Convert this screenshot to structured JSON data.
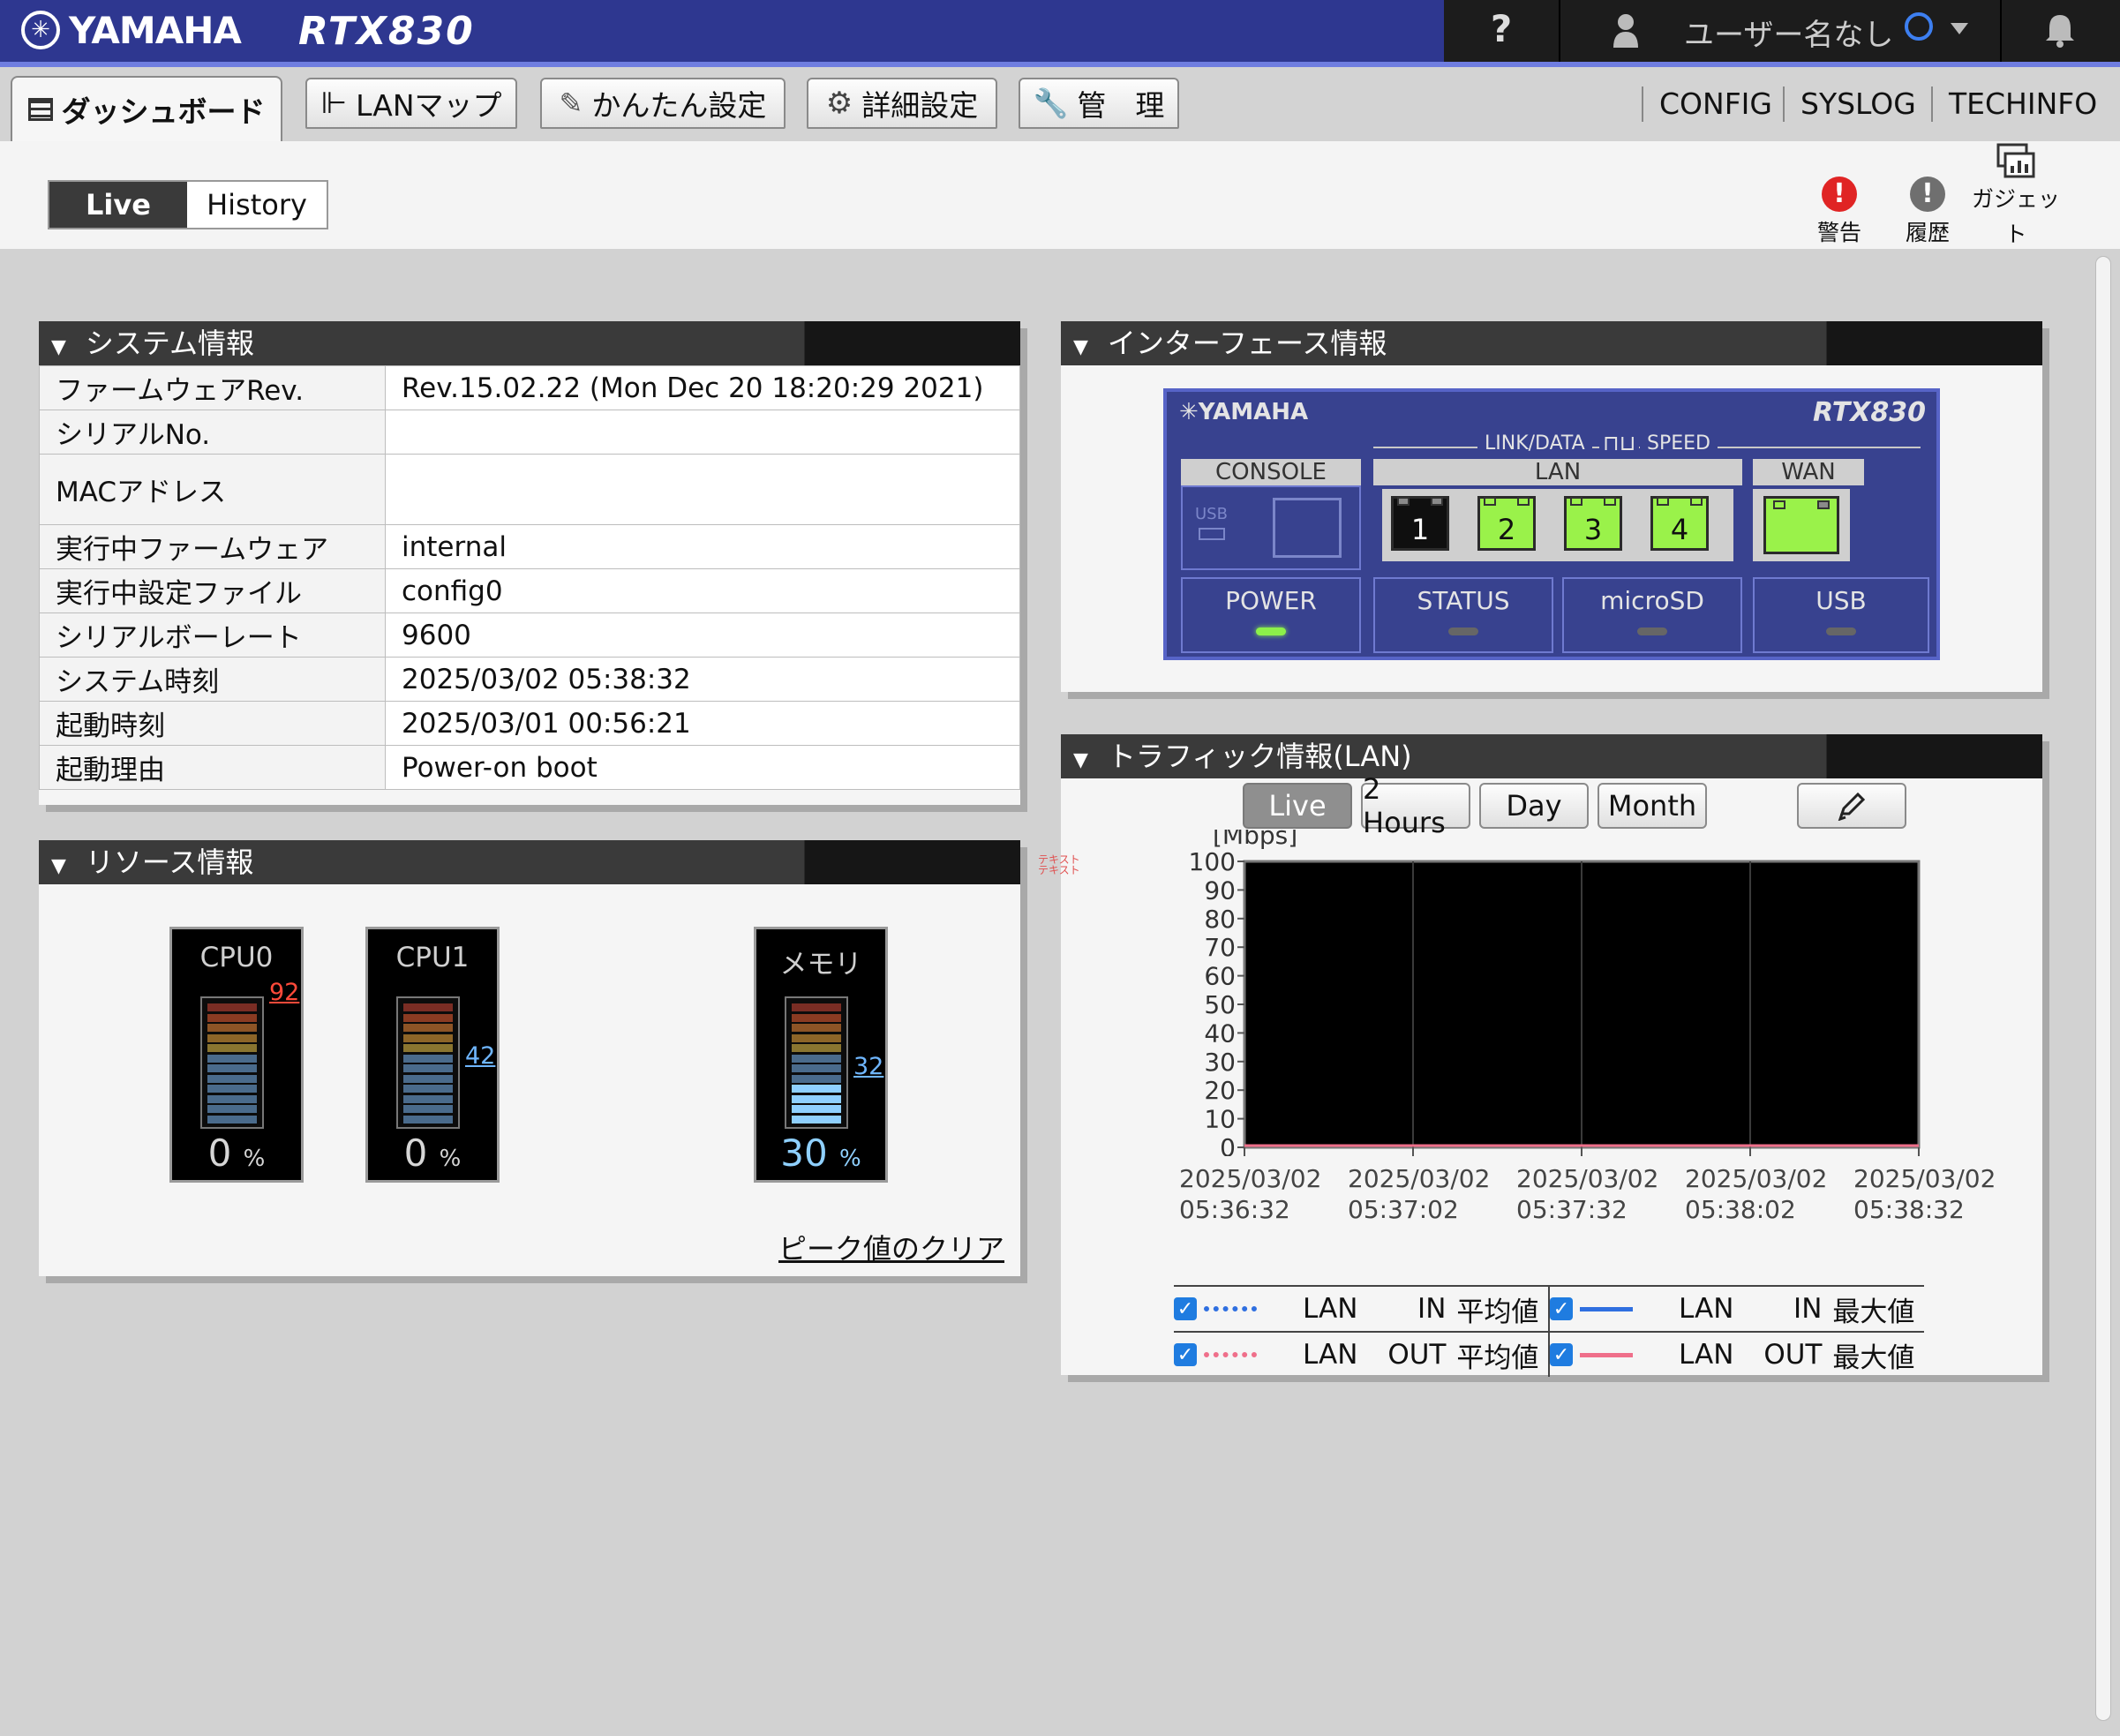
{
  "app": {
    "brand": "YAMAHA",
    "model": "RTX830"
  },
  "topbar": {
    "help": "?",
    "user_name": "ユーザー名なし"
  },
  "tabs": [
    {
      "label": "ダッシュボード",
      "icon": "dashboard-icon"
    },
    {
      "label": "LANマップ",
      "icon": "lan-map-icon"
    },
    {
      "label": "かんたん設定",
      "icon": "wand-icon"
    },
    {
      "label": "詳細設定",
      "icon": "gear-icon"
    },
    {
      "label": "管　理",
      "icon": "wrench-icon"
    }
  ],
  "top_links": [
    "CONFIG",
    "SYSLOG",
    "TECHINFO"
  ],
  "view_toggle": {
    "live": "Live",
    "history": "History"
  },
  "header_icons": {
    "warning": "警告",
    "history": "履歴",
    "gadget_line1": "ガジェッ",
    "gadget_line2": "ト"
  },
  "system": {
    "title": "システム情報",
    "rows": [
      {
        "key": "ファームウェアRev.",
        "value": "Rev.15.02.22 (Mon Dec 20 18:20:29 2021)"
      },
      {
        "key": "シリアルNo.",
        "value": ""
      },
      {
        "key": "MACアドレス",
        "value": ""
      },
      {
        "key": "実行中ファームウェア",
        "value": "internal"
      },
      {
        "key": "実行中設定ファイル",
        "value": "config0"
      },
      {
        "key": "シリアルボーレート",
        "value": "9600"
      },
      {
        "key": "システム時刻",
        "value": "2025/03/02 05:38:32"
      },
      {
        "key": "起動時刻",
        "value": "2025/03/01 00:56:21"
      },
      {
        "key": "起動理由",
        "value": "Power-on boot"
      }
    ]
  },
  "resource": {
    "title": "リソース情報",
    "gauges": [
      {
        "label": "CPU0",
        "value": "0",
        "unit": "%",
        "peak": "92",
        "peak_color": "#ff4a3a",
        "level": 0
      },
      {
        "label": "CPU1",
        "value": "0",
        "unit": "%",
        "peak": "42",
        "peak_color": "#6fb6ff",
        "level": 0
      },
      {
        "label": "メモリ",
        "value": "30",
        "unit": "%",
        "peak": "32",
        "peak_color": "#6fb6ff",
        "level": 30
      }
    ],
    "clear_peak": "ピーク値のクリア"
  },
  "interface": {
    "title": "インターフェース情報",
    "device": {
      "brand": "YAMAHA",
      "model": "RTX830",
      "link_data": "LINK/DATA",
      "speed": "SPEED",
      "console": "CONSOLE",
      "lan": "LAN",
      "wan": "WAN",
      "usb_small": "USB",
      "ports": [
        "1",
        "2",
        "3",
        "4"
      ],
      "port_states": [
        "down",
        "up",
        "up",
        "up"
      ],
      "leds": [
        {
          "label": "POWER",
          "on": true
        },
        {
          "label": "STATUS",
          "on": false
        },
        {
          "label": "microSD",
          "on": false
        },
        {
          "label": "USB",
          "on": false
        }
      ]
    }
  },
  "traffic": {
    "title": "トラフィック情報(LAN)",
    "buttons": [
      "Live",
      "2 Hours",
      "Day",
      "Month"
    ],
    "edit_icon": "pencil-icon",
    "note": "テキスト テキスト",
    "legend": [
      {
        "iface": "LAN",
        "dir": "IN",
        "stat": "平均値",
        "style": "dotted",
        "color": "#2f6fe0"
      },
      {
        "iface": "LAN",
        "dir": "IN",
        "stat": "最大値",
        "style": "solid",
        "color": "#2f6fe0"
      },
      {
        "iface": "LAN",
        "dir": "OUT",
        "stat": "平均値",
        "style": "dotted",
        "color": "#ef6f8a"
      },
      {
        "iface": "LAN",
        "dir": "OUT",
        "stat": "最大値",
        "style": "solid",
        "color": "#ef6f8a"
      }
    ]
  },
  "chart_data": {
    "type": "line",
    "title": "",
    "ylabel": "[Mbps]",
    "ylim": [
      0,
      100
    ],
    "yticks": [
      "100",
      "90",
      "80",
      "70",
      "60",
      "50",
      "40",
      "30",
      "20",
      "10",
      "0"
    ],
    "x": [
      {
        "date": "2025/03/02",
        "time": "05:36:32"
      },
      {
        "date": "2025/03/02",
        "time": "05:37:02"
      },
      {
        "date": "2025/03/02",
        "time": "05:37:32"
      },
      {
        "date": "2025/03/02",
        "time": "05:38:02"
      },
      {
        "date": "2025/03/02",
        "time": "05:38:32"
      }
    ],
    "series": [
      {
        "name": "LAN IN 平均値",
        "values": [
          0,
          0,
          0,
          0,
          0
        ]
      },
      {
        "name": "LAN OUT 平均値",
        "values": [
          0,
          0,
          0,
          0,
          0
        ]
      },
      {
        "name": "LAN IN 最大値",
        "values": [
          0,
          0,
          0,
          0,
          0
        ]
      },
      {
        "name": "LAN OUT 最大値",
        "values": [
          0,
          0,
          0,
          0,
          0
        ]
      }
    ],
    "grid": true,
    "background": "#000000"
  }
}
